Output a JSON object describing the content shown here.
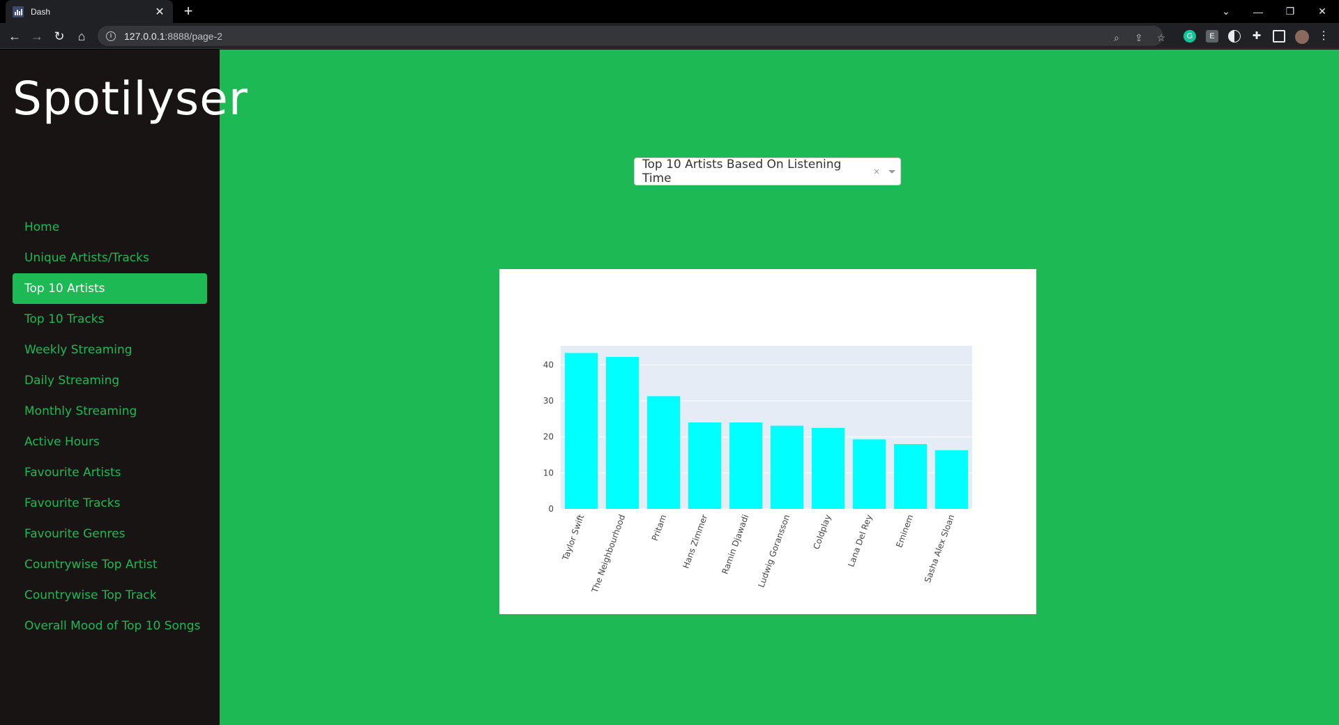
{
  "browser": {
    "tab_title": "Dash",
    "tab_close": "✕",
    "new_tab": "+",
    "url_host": "127.0.0.1",
    "url_rest": ":8888/page-2",
    "controls": {
      "minimize": "—",
      "restore": "❐",
      "close": "✕",
      "tab_list": "⌄"
    },
    "icons": [
      "back-icon",
      "forward-icon",
      "reload-icon",
      "home-icon",
      "zoom-icon",
      "share-icon",
      "star-icon",
      "grammarly-icon",
      "extension-e-icon",
      "dark-mode-icon",
      "puzzle-icon",
      "sidepanel-icon",
      "avatar",
      "menu-icon"
    ]
  },
  "sidebar": {
    "brand": "Spotilyser",
    "items": [
      {
        "label": "Home"
      },
      {
        "label": "Unique Artists/Tracks"
      },
      {
        "label": "Top 10 Artists",
        "active": true
      },
      {
        "label": "Top 10 Tracks"
      },
      {
        "label": "Weekly Streaming"
      },
      {
        "label": "Daily Streaming"
      },
      {
        "label": "Monthly Streaming"
      },
      {
        "label": "Active Hours"
      },
      {
        "label": "Favourite Artists"
      },
      {
        "label": "Favourite Tracks"
      },
      {
        "label": "Favourite Genres"
      },
      {
        "label": "Countrywise Top Artist"
      },
      {
        "label": "Countrywise Top Track"
      },
      {
        "label": "Overall Mood of Top 10 Songs"
      }
    ]
  },
  "dropdown": {
    "value": "Top 10 Artists Based On Listening Time",
    "clear": "×"
  },
  "colors": {
    "spotify_green": "#1db954",
    "sidebar_bg": "#191414",
    "bar_color": "#00ffff",
    "plot_bg": "#e5ecf6"
  },
  "chart_data": {
    "type": "bar",
    "categories": [
      "Taylor Swift",
      "The Neighbourhood",
      "Pritam",
      "Hans Zimmer",
      "Ramin Djawadi",
      "Ludwig Goransson",
      "Coldplay",
      "Lana Del Rey",
      "Eminem",
      "Sasha Alex Sloan"
    ],
    "values": [
      43.3,
      42.2,
      31.3,
      24.0,
      24.0,
      23.1,
      22.5,
      19.3,
      18.0,
      16.3
    ],
    "yticks": [
      "0",
      "10",
      "20",
      "30",
      "40"
    ],
    "ylim": [
      0,
      45.3
    ],
    "title": "",
    "xlabel": "",
    "ylabel": "",
    "grid": true
  }
}
